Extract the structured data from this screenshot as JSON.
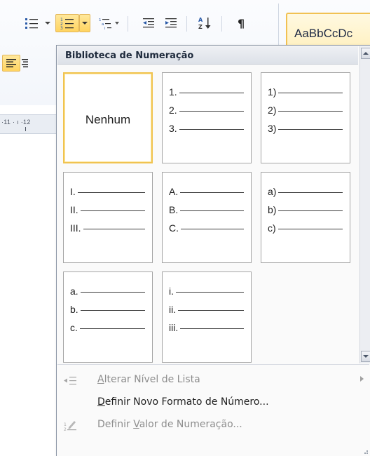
{
  "ribbon": {
    "style_gallery_sample": "AaBbCcDc",
    "ruler_text": "·11 · ı ·12"
  },
  "dropdown": {
    "header": "Biblioteca de Numeração",
    "tiles": [
      {
        "kind": "none",
        "label": "Nenhum",
        "selected": true
      },
      {
        "kind": "list",
        "markers": [
          "1.",
          "2.",
          "3."
        ]
      },
      {
        "kind": "list",
        "markers": [
          "1)",
          "2)",
          "3)"
        ]
      },
      {
        "kind": "list",
        "markers": [
          "I.",
          "II.",
          "III."
        ]
      },
      {
        "kind": "list",
        "markers": [
          "A.",
          "B.",
          "C."
        ]
      },
      {
        "kind": "list",
        "markers": [
          "a)",
          "b)",
          "c)"
        ]
      },
      {
        "kind": "list",
        "markers": [
          "a.",
          "b.",
          "c."
        ]
      },
      {
        "kind": "list",
        "markers": [
          "i.",
          "ii.",
          "iii."
        ]
      }
    ],
    "menu": {
      "change_level": {
        "pre": "",
        "u": "A",
        "post": "lterar Nível de Lista",
        "enabled": false,
        "icon": "change-list-level-icon"
      },
      "define_format": {
        "pre": "",
        "u": "D",
        "post": "efinir Novo Formato de Número...",
        "enabled": true,
        "icon": ""
      },
      "set_value": {
        "pre": "Definir ",
        "u": "V",
        "post": "alor de Numeração...",
        "enabled": false,
        "icon": "set-numbering-value-icon"
      }
    }
  },
  "colors": {
    "accent_highlight": "#ffd460",
    "selected_border": "#f0c350",
    "disabled_text": "#8d8d8d"
  }
}
